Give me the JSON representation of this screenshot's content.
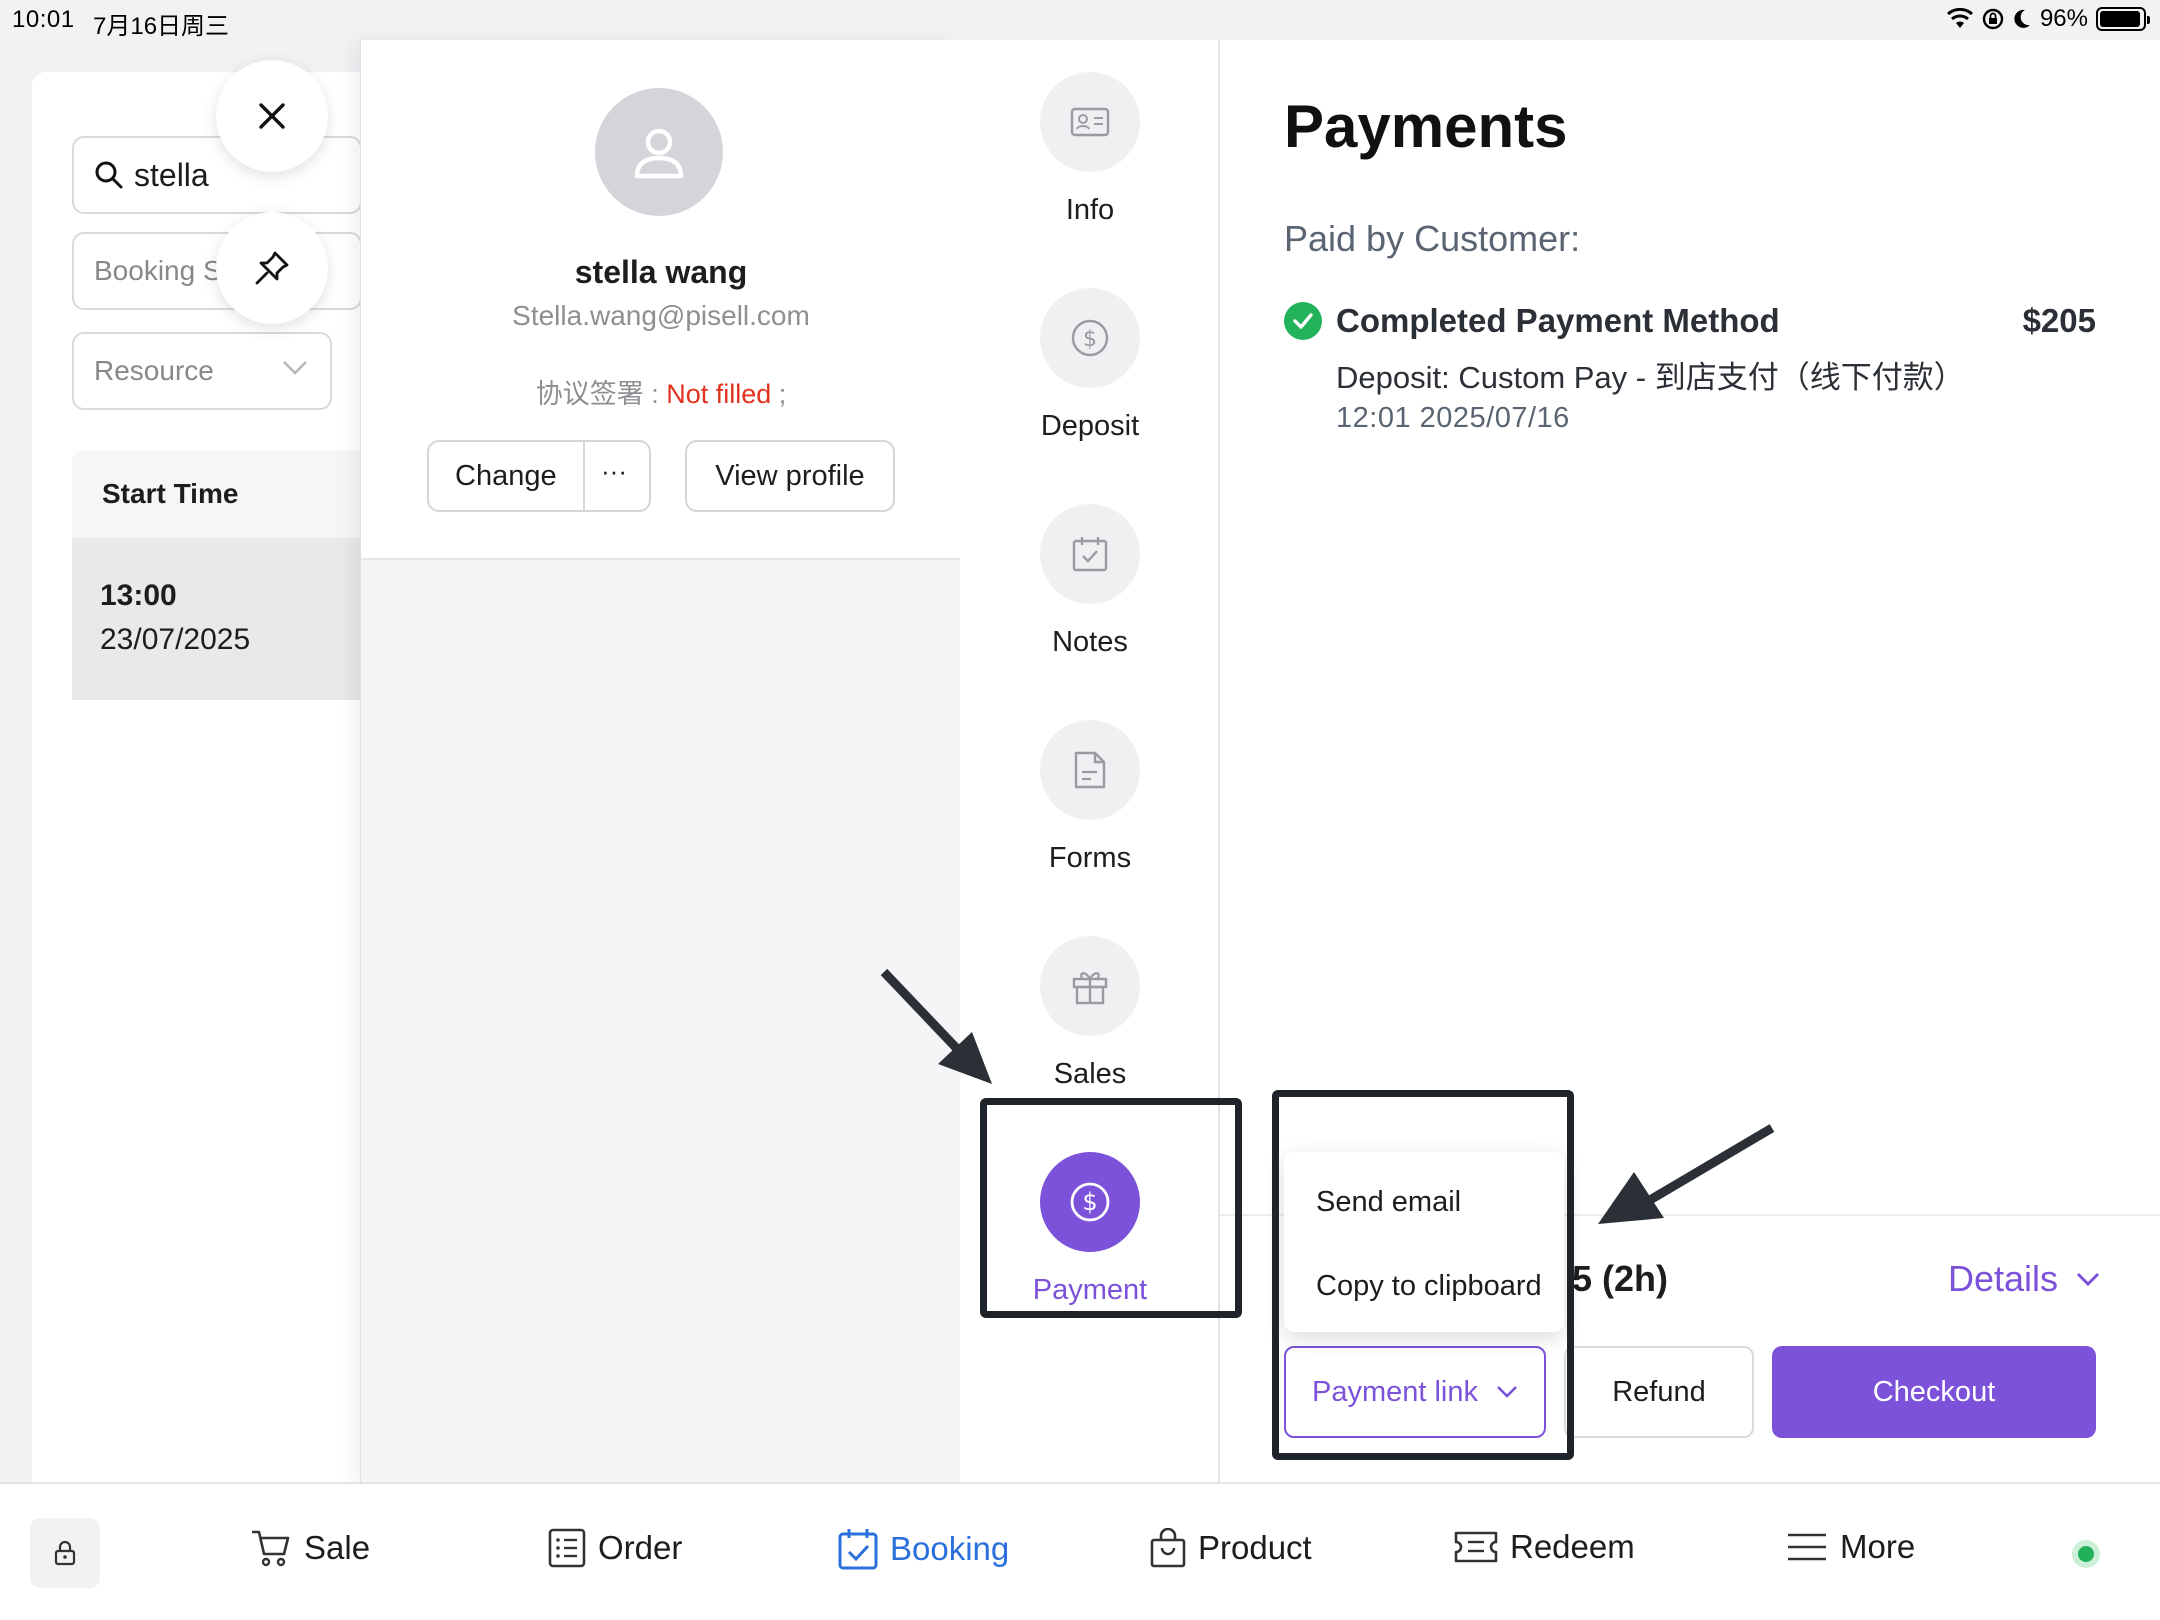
{
  "status_bar": {
    "time": "10:01",
    "date": "7月16日周三",
    "battery": "96%",
    "battery_level": 0.96
  },
  "left_panel": {
    "search_value": "stella",
    "booking_placeholder": "Booking S",
    "resource_placeholder": "Resource",
    "column_header": "Start Time",
    "rows": [
      {
        "time": "13:00",
        "date": "23/07/2025"
      }
    ]
  },
  "customer": {
    "name": "stella wang",
    "email": "Stella.wang@pisell.com",
    "agreement_label": "协议签署 : ",
    "agreement_status": "Not filled",
    "agreement_suffix": " ;",
    "change_label": "Change",
    "more_label": "···",
    "view_profile_label": "View profile"
  },
  "tabs": {
    "info": "Info",
    "deposit": "Deposit",
    "notes": "Notes",
    "forms": "Forms",
    "sales": "Sales",
    "payment": "Payment"
  },
  "payments": {
    "title": "Payments",
    "paid_by": "Paid by Customer:",
    "method_label": "Completed Payment Method",
    "amount": "$205",
    "detail": "Deposit: Custom Pay - 到店支付（线下付款）",
    "timestamp": "12:01 2025/07/16",
    "duration": "5 (2h)",
    "details_label": "Details",
    "payment_link_label": "Payment link",
    "refund_label": "Refund",
    "checkout_label": "Checkout",
    "dropdown": [
      "Send email",
      "Copy to clipboard"
    ]
  },
  "bottom_nav": {
    "items": [
      "Sale",
      "Order",
      "Booking",
      "Product",
      "Redeem",
      "More"
    ],
    "active": "Booking"
  },
  "colors": {
    "accent": "#7b52d9",
    "nav_active": "#2a6fdb",
    "success": "#21b25a",
    "danger": "#e0321e",
    "annotation": "#1e242a"
  }
}
